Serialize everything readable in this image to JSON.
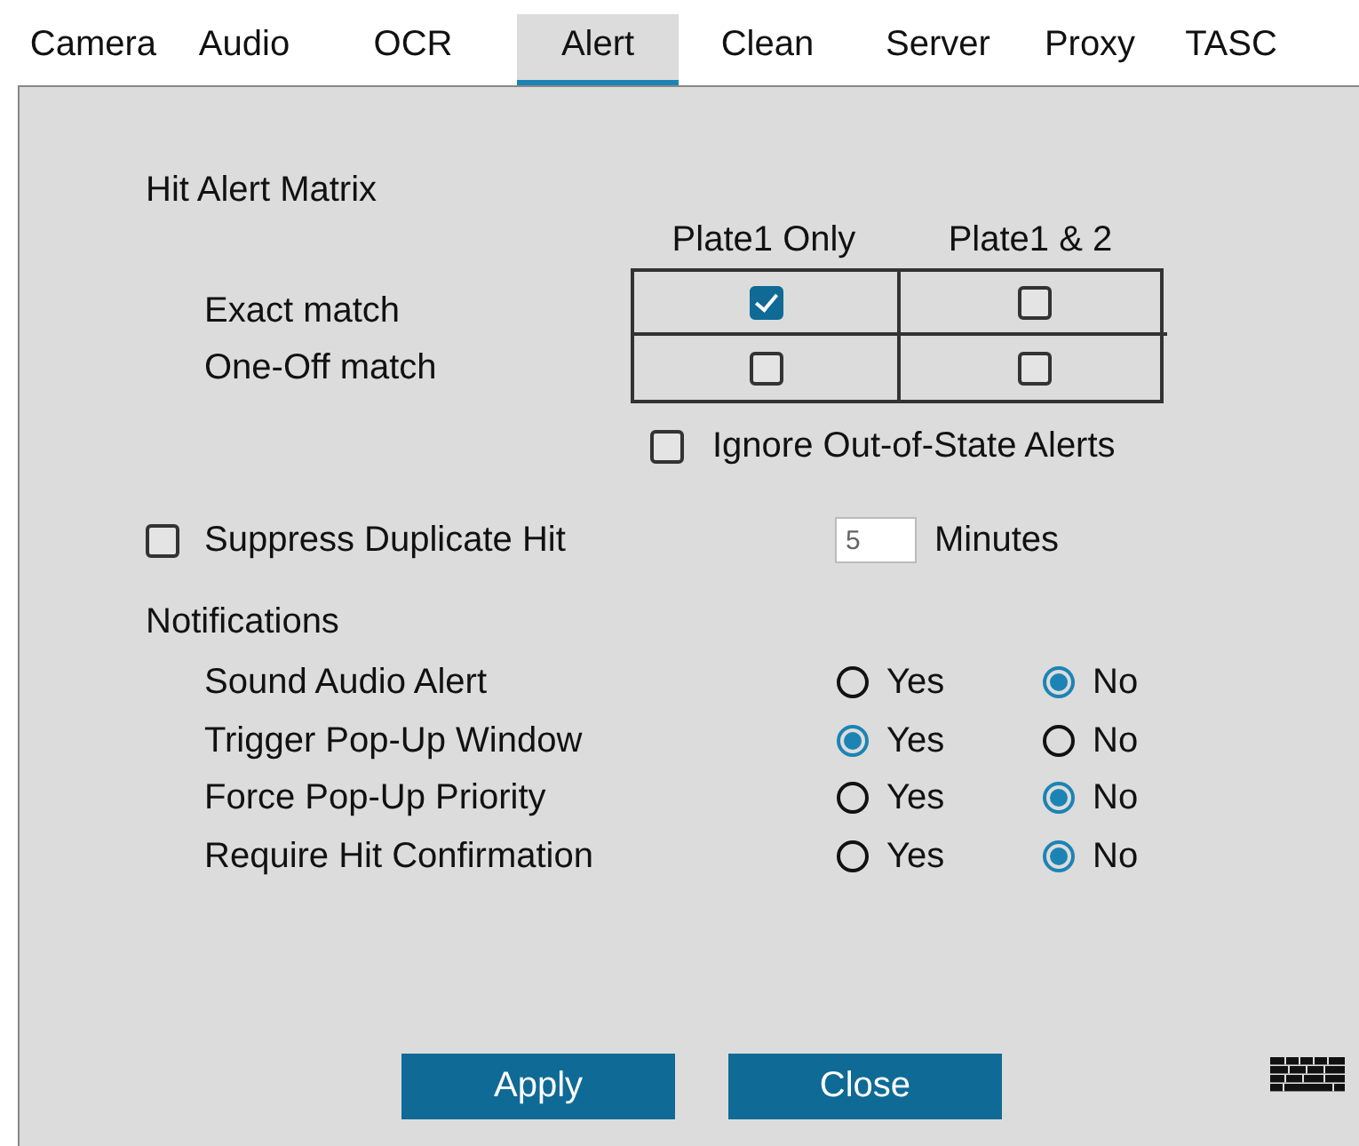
{
  "tabs": [
    {
      "label": "Camera",
      "selected": false
    },
    {
      "label": "Audio",
      "selected": false
    },
    {
      "label": "OCR",
      "selected": false
    },
    {
      "label": "Alert",
      "selected": true
    },
    {
      "label": "Clean",
      "selected": false
    },
    {
      "label": "Server",
      "selected": false
    },
    {
      "label": "Proxy",
      "selected": false
    },
    {
      "label": "TASC",
      "selected": false
    }
  ],
  "hit_alert_matrix": {
    "title": "Hit Alert Matrix",
    "columns": [
      "Plate1 Only",
      "Plate1 & 2"
    ],
    "rows": [
      {
        "label": "Exact match",
        "cells": [
          {
            "checked": true
          },
          {
            "checked": false
          }
        ]
      },
      {
        "label": "One-Off match",
        "cells": [
          {
            "checked": false
          },
          {
            "checked": false
          }
        ]
      }
    ],
    "ignore_out_of_state": {
      "label": "Ignore Out-of-State Alerts",
      "checked": false
    }
  },
  "suppress_duplicate": {
    "label": "Suppress Duplicate Hit",
    "checked": false,
    "value": "5",
    "unit": "Minutes"
  },
  "notifications": {
    "title": "Notifications",
    "rows": [
      {
        "label": "Sound Audio Alert",
        "options": [
          {
            "label": "Yes",
            "selected": false
          },
          {
            "label": "No",
            "selected": true
          }
        ]
      },
      {
        "label": "Trigger Pop-Up Window",
        "options": [
          {
            "label": "Yes",
            "selected": true
          },
          {
            "label": "No",
            "selected": false
          }
        ]
      },
      {
        "label": "Force Pop-Up Priority",
        "options": [
          {
            "label": "Yes",
            "selected": false
          },
          {
            "label": "No",
            "selected": true
          }
        ]
      },
      {
        "label": "Require Hit Confirmation",
        "options": [
          {
            "label": "Yes",
            "selected": false
          },
          {
            "label": "No",
            "selected": true
          }
        ]
      }
    ]
  },
  "buttons": [
    "Apply",
    "Close"
  ]
}
